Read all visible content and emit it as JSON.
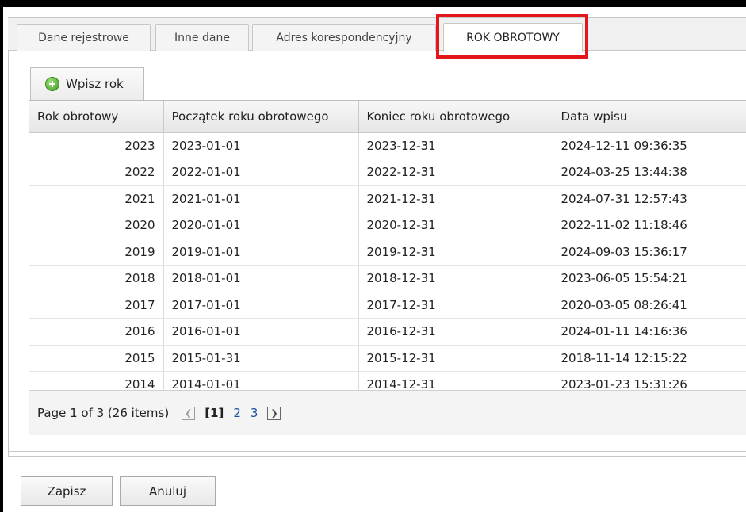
{
  "tabs": [
    {
      "label": "Dane rejestrowe"
    },
    {
      "label": "Inne dane"
    },
    {
      "label": "Adres korespondencyjny"
    },
    {
      "label": "ROK OBROTOWY"
    }
  ],
  "toolbar": {
    "add_label": "Wpisz rok"
  },
  "grid": {
    "columns": [
      "Rok obrotowy",
      "Początek roku obrotowego",
      "Koniec roku obrotowego",
      "Data wpisu"
    ],
    "rows": [
      [
        "2023",
        "2023-01-01",
        "2023-12-31",
        "2024-12-11 09:36:35"
      ],
      [
        "2022",
        "2022-01-01",
        "2022-12-31",
        "2024-03-25 13:44:38"
      ],
      [
        "2021",
        "2021-01-01",
        "2021-12-31",
        "2024-07-31 12:57:43"
      ],
      [
        "2020",
        "2020-01-01",
        "2020-12-31",
        "2022-11-02 11:18:46"
      ],
      [
        "2019",
        "2019-01-01",
        "2019-12-31",
        "2024-09-03 15:36:17"
      ],
      [
        "2018",
        "2018-01-01",
        "2018-12-31",
        "2023-06-05 15:54:21"
      ],
      [
        "2017",
        "2017-01-01",
        "2017-12-31",
        "2020-03-05 08:26:41"
      ],
      [
        "2016",
        "2016-01-01",
        "2016-12-31",
        "2024-01-11 14:16:36"
      ],
      [
        "2015",
        "2015-01-31",
        "2015-12-31",
        "2018-11-14 12:15:22"
      ],
      [
        "2014",
        "2014-01-01",
        "2014-12-31",
        "2023-01-23 15:31:26"
      ]
    ]
  },
  "pager": {
    "summary": "Page 1 of 3 (26 items)",
    "prev_icon": "chevron-left-icon",
    "next_icon": "chevron-right-icon",
    "current": "[1]",
    "pages": [
      "2",
      "3"
    ]
  },
  "footer": {
    "save_label": "Zapisz",
    "cancel_label": "Anuluj"
  },
  "colors": {
    "highlight": "#e2161b",
    "link": "#1a4fa3",
    "add_icon": "#3c9a1f"
  }
}
